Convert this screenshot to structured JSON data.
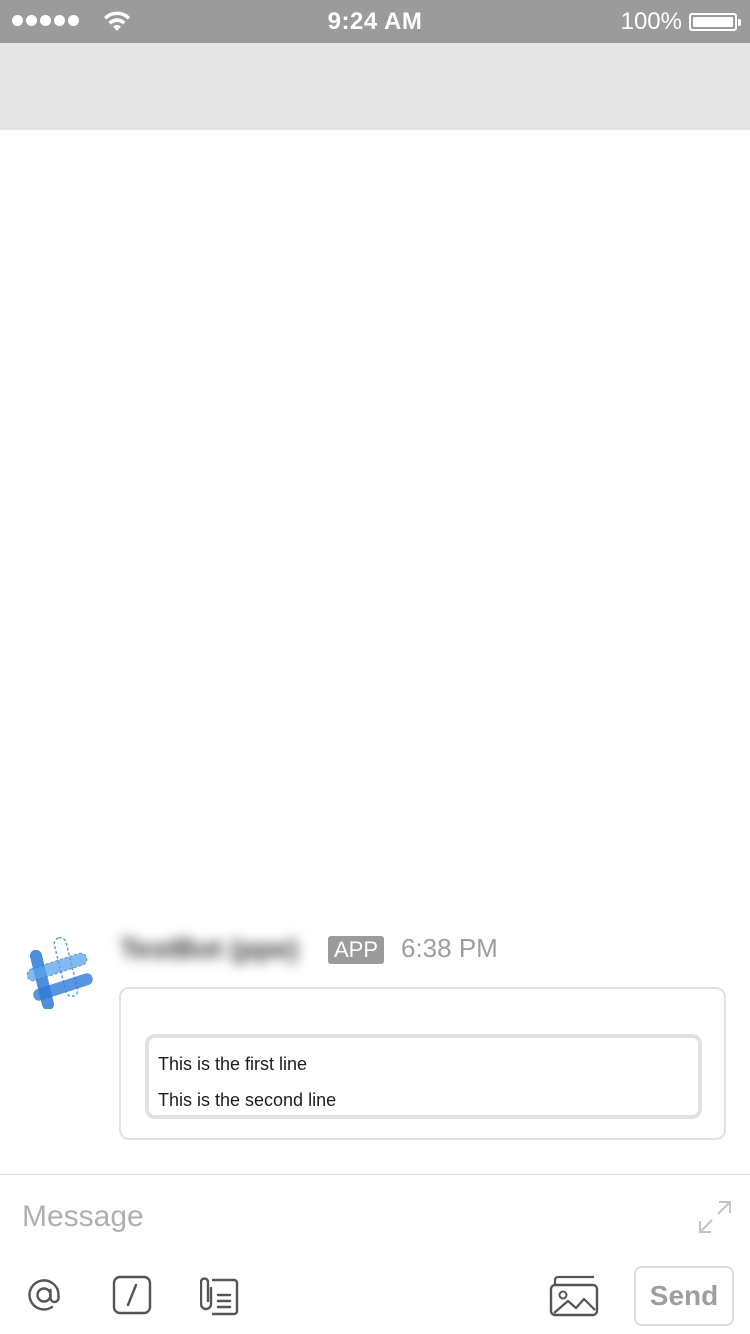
{
  "status_bar": {
    "time": "9:24 AM",
    "battery_percent": "100%",
    "signal_bars": 5,
    "battery_level": 1.0
  },
  "message": {
    "sender": "TestBot (ppe)",
    "badge": "APP",
    "timestamp": "6:38 PM",
    "attachment_lines": [
      "This is the first line",
      "This is the second line"
    ]
  },
  "composer": {
    "placeholder": "Message",
    "value": "",
    "send_label": "Send",
    "icons": [
      "mention-icon",
      "slash-command-icon",
      "files-icon",
      "photo-icon",
      "expand-icon"
    ]
  },
  "colors": {
    "status_bar_bg": "#9b9b9b",
    "nav_bar_bg": "#e6e6e6",
    "avatar_blue": "#2e7bd6",
    "border": "#e1e1e1",
    "muted_text": "#9e9e9e"
  }
}
